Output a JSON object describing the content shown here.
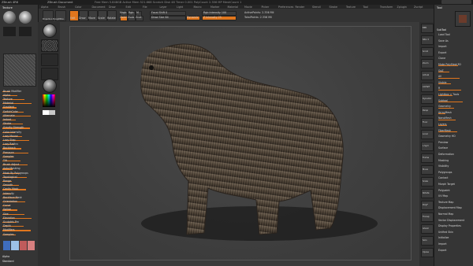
{
  "title_bar": {
    "left": "ZBrush 4R6",
    "center": "ZBrush Document",
    "right": "Free Mem 5.848GB  Active Mem 521.668  Scratch Disk 48  Timer 0.001  PolyCount 2.356 MP  MeshCount 1"
  },
  "menu": [
    "Alpha",
    "Brush",
    "Color",
    "Document",
    "Draw",
    "Edit",
    "File",
    "Layer",
    "Light",
    "Macro",
    "Marker",
    "Material",
    "Movie",
    "Picker",
    "Preferences",
    "Render",
    "Stencil",
    "Stroke",
    "Texture",
    "Tool",
    "Transform",
    "Zplugin",
    "Zscript"
  ],
  "top_shelf": {
    "projection_master": "Projection Master",
    "lightbox": "LightBox",
    "quick_sketch": "Quick Sketch",
    "edit": "Edit",
    "draw": "Draw",
    "move": "Move",
    "scale": "Scale",
    "rotate": "Rotate",
    "mrgb": "Mrgb",
    "rgb": "Rgb",
    "m": "M",
    "zadd": "Zadd",
    "zsub": "Zsub",
    "zcut": "Zcut",
    "focal_shift": "Focal Shift 0",
    "draw_size": "Draw Size 64",
    "dynamic": "Dynamic",
    "rgb_intensity": "Rgb Intensity 100",
    "z_intensity": "Z Intensity 25",
    "active_points": "ActivePoints: 2.356 Mil",
    "total_points": "TotalPoints: 2.356 Mil"
  },
  "left_tray": {
    "header": "Texture",
    "rows": [
      "Brush Modifier",
      "Alpha",
      "Texture",
      "Material",
      "Gradient",
      "SwitchColor",
      "Alternate",
      "Imbed",
      "Stroke",
      "Gravity Strength",
      "Color Intensity",
      "Lazy Mouse",
      "Lazy Step",
      "Lazy Radius",
      "Backtrack",
      "Pressure",
      "Samples",
      "Tilt",
      "Brush Adjust",
      "Auto Masking",
      "Mask By Polygroups",
      "Topological",
      "Range",
      "Smooth",
      "Cavity Mask",
      "Intensity",
      "Backface Mask",
      "Orientation",
      "Curve",
      "Spline",
      "Size",
      "Elevation",
      "Sculptris Pro",
      "Depth",
      "Modifiers",
      "Samples"
    ],
    "footer": [
      "Alpha",
      "Standard"
    ],
    "color_hex": [
      "#3f6dbd",
      "#9cc0e6",
      "#c05b5b",
      "#d77f7f"
    ]
  },
  "color_picker": {
    "label": "Current Color",
    "red": "Red 128",
    "green": "Green 128",
    "blue": "Blue 128"
  },
  "right_tray": {
    "header": "Tool",
    "subheader": "SubTool",
    "rows": [
      "Load Tool",
      "Save As",
      "Import",
      "Export",
      "Clone",
      "Make PolyMesh3D",
      "GoZ",
      "All",
      "Visible",
      "R",
      "Lightbox > Tools",
      "Subtool",
      "Geometry",
      "ArrayMesh",
      "NanoMesh",
      "Layers",
      "FiberMesh",
      "Geometry HD",
      "Preview",
      "Surface",
      "Deformation",
      "Masking",
      "Visibility",
      "Polygroups",
      "Contact",
      "Morph Target",
      "Polypaint",
      "UV Map",
      "Texture Map",
      "Displacement Map",
      "Normal Map",
      "Vector Displacement",
      "Display Properties",
      "Unified Skin",
      "Initialize",
      "Import",
      "Export"
    ]
  },
  "right_shelf": [
    "BPR",
    "SPix 3",
    "Scroll",
    "Zoom",
    "Actual",
    "AAHalf",
    "Dynamic",
    "Persp",
    "Floor",
    "Local",
    "L.Sym",
    "Frame",
    "Move",
    "Scale",
    "Rotate",
    "PolyF",
    "Transp",
    "Ghost",
    "Solo",
    "Xpose"
  ],
  "colors": {
    "accent": "#e0761d",
    "ui_dark": "#2a2a2a",
    "canvas": "#3f3f3f"
  }
}
